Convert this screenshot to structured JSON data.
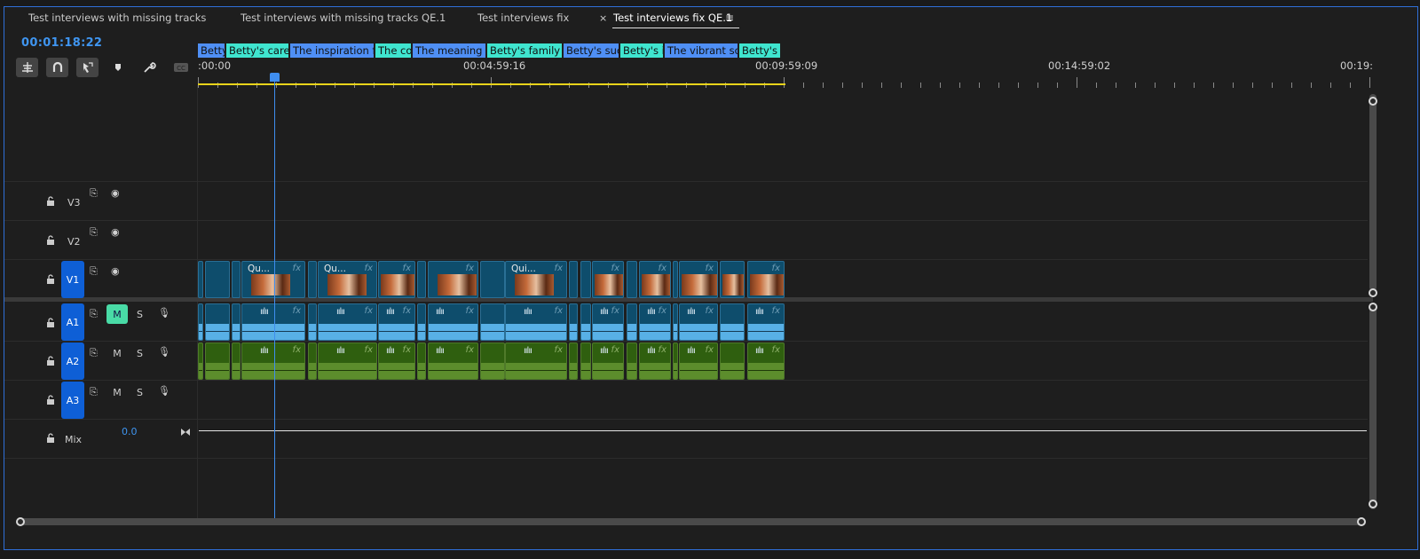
{
  "tabs": [
    {
      "label": "Test interviews with missing tracks"
    },
    {
      "label": "Test interviews with missing tracks QE.1"
    },
    {
      "label": "Test interviews fix"
    },
    {
      "label": "Test interviews fix QE.1"
    }
  ],
  "tab_close": "×",
  "tab_menu": "≡",
  "timecode": "00:01:18:22",
  "markers": [
    {
      "label": "Betty's",
      "color": "blue"
    },
    {
      "label": "Betty's career",
      "color": "teal"
    },
    {
      "label": "The inspiration fr",
      "color": "blue"
    },
    {
      "label": "The co",
      "color": "teal"
    },
    {
      "label": "The meaning l",
      "color": "blue"
    },
    {
      "label": "Betty's family b",
      "color": "teal"
    },
    {
      "label": "Betty's suc",
      "color": "blue"
    },
    {
      "label": "Betty's i",
      "color": "teal"
    },
    {
      "label": "The vibrant so",
      "color": "blue"
    },
    {
      "label": "Betty's",
      "color": "teal"
    }
  ],
  "ruler": {
    "labels": [
      ":00:00",
      "00:04:59:16",
      "00:09:59:09",
      "00:14:59:02",
      "00:19:"
    ]
  },
  "tracks": {
    "v3": "V3",
    "v2": "V2",
    "v1": "V1",
    "a1": "A1",
    "a2": "A2",
    "a3": "A3",
    "mix": "Mix",
    "mute": "M",
    "solo": "S"
  },
  "mix_value": "0.0",
  "clips": {
    "v1_names": [
      "Qu...",
      "Qu...",
      "Qui..."
    ],
    "fx": "fx",
    "audio_icon": "ıılıı"
  },
  "colors": {
    "accent": "#3f95f0",
    "marker_blue": "#4f8ff5",
    "marker_teal": "#3fe5cf",
    "workarea": "#e8d31a"
  }
}
